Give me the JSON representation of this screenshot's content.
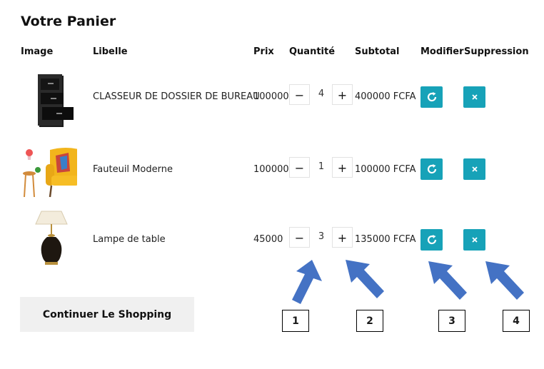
{
  "page": {
    "title": "Votre Panier"
  },
  "table": {
    "headers": [
      "Image",
      "Libelle",
      "Prix",
      "Quantité",
      "Subtotal",
      "Modifier",
      "Suppression"
    ],
    "rows": [
      {
        "name": "CLASSEUR DE DOSSIER DE BUREAU",
        "price": "100000",
        "qty": "4",
        "subtotal": "400000 FCFA",
        "image": "filing-cabinet"
      },
      {
        "name": "Fauteuil Moderne",
        "price": "100000",
        "qty": "1",
        "subtotal": "100000 FCFA",
        "image": "armchair"
      },
      {
        "name": "Lampe de table",
        "price": "45000",
        "qty": "3",
        "subtotal": "135000 FCFA",
        "image": "table-lamp"
      }
    ],
    "minus": "−",
    "plus": "+",
    "refresh_icon": "refresh-icon",
    "delete_icon": "close-icon"
  },
  "continue_label": "Continuer Le Shopping",
  "annotations": [
    "1",
    "2",
    "3",
    "4"
  ],
  "colors": {
    "accent": "#17a2b8",
    "arrow": "#4472c4"
  }
}
